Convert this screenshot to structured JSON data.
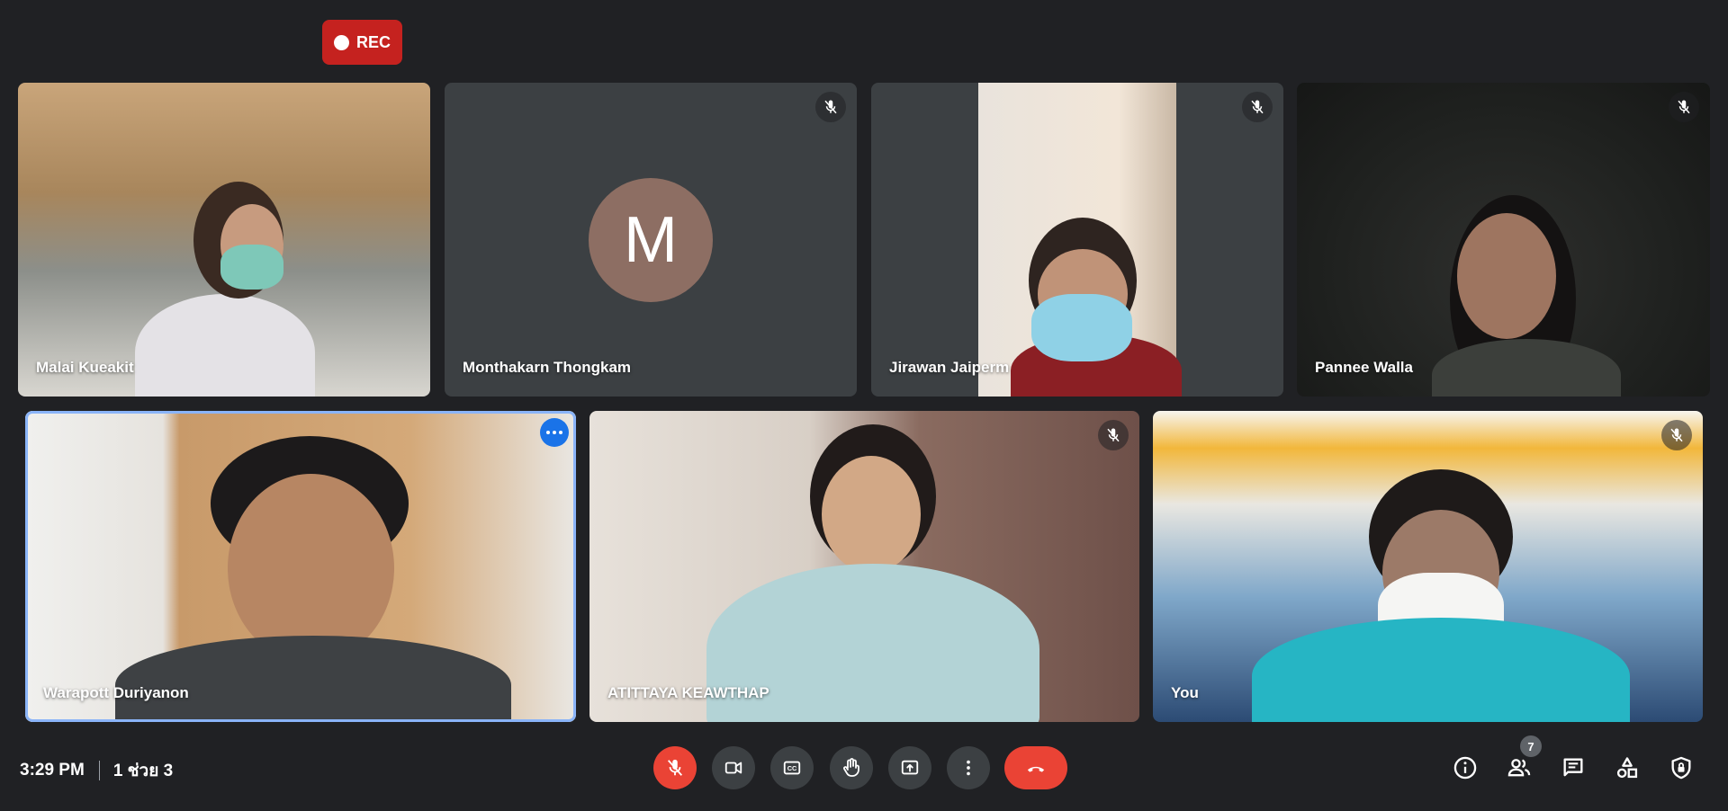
{
  "recording": {
    "label": "REC"
  },
  "participants": [
    {
      "name": "Malai Kueakit",
      "muted": false
    },
    {
      "name": "Monthakarn Thongkam",
      "muted": true,
      "initial": "M",
      "avatar_color": "#8d6e63"
    },
    {
      "name": "Jirawan Jaiperm",
      "muted": true
    },
    {
      "name": "Pannee Walla",
      "muted": true
    },
    {
      "name": "Warapott Duriyanon",
      "muted": false,
      "active_speaker": true
    },
    {
      "name": "ATITTAYA KEAWTHAP",
      "muted": true
    },
    {
      "name": "You",
      "muted": true
    }
  ],
  "footer": {
    "time": "3:29 PM",
    "meeting_name": "1 ช่วย 3",
    "people_count": "7"
  },
  "controls": [
    "mic-off",
    "camera",
    "captions",
    "raise-hand",
    "present",
    "more-options",
    "leave-call"
  ],
  "right_controls": [
    "meeting-details",
    "people",
    "chat",
    "activities",
    "host-controls"
  ],
  "colors": {
    "background": "#202124",
    "tile": "#3c4043",
    "danger": "#ea4335",
    "rec": "#c5221f",
    "active_border": "#8ab4f8"
  }
}
